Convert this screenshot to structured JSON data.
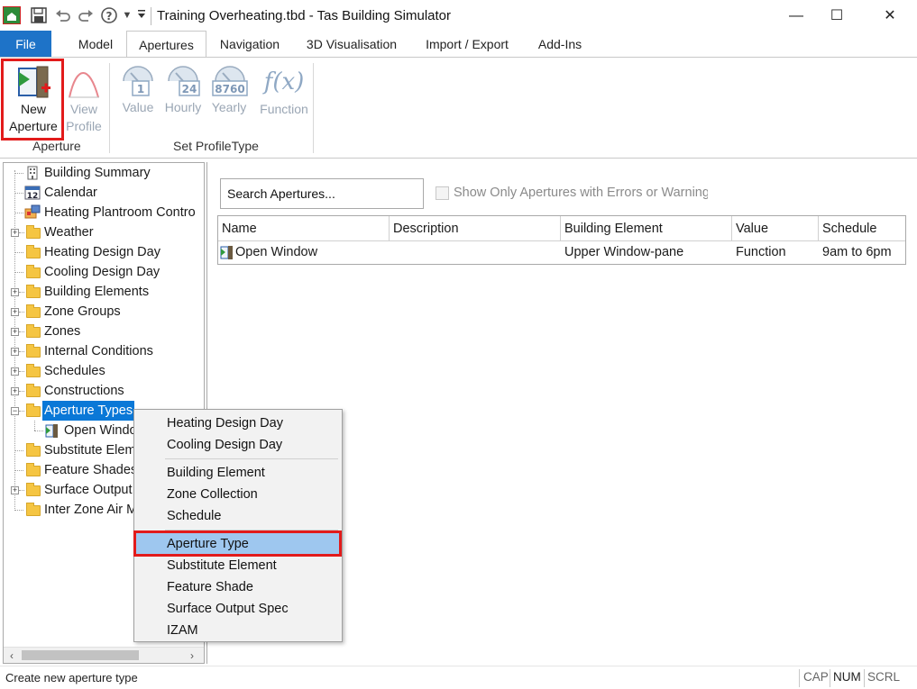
{
  "window": {
    "title": "Training Overheating.tbd - Tas Building Simulator",
    "minimize": "—",
    "maximize": "☐",
    "close": "✕"
  },
  "quick_access": {
    "icons": [
      "app-icon",
      "save-icon",
      "undo-icon",
      "redo-icon",
      "help-icon",
      "dropdown-icon",
      "customize-icon"
    ]
  },
  "tabs": [
    {
      "label": "File"
    },
    {
      "label": "Model"
    },
    {
      "label": "Apertures"
    },
    {
      "label": "Navigation"
    },
    {
      "label": "3D Visualisation"
    },
    {
      "label": "Import / Export"
    },
    {
      "label": "Add-Ins"
    }
  ],
  "ribbon": {
    "aperture_group": {
      "label": "Aperture",
      "new_aperture": {
        "line1": "New",
        "line2": "Aperture"
      },
      "view_profile": {
        "line1": "View",
        "line2": "Profile"
      }
    },
    "profile_group": {
      "label": "Set ProfileType",
      "value": {
        "label": "Value",
        "badge": "1"
      },
      "hourly": {
        "label": "Hourly",
        "badge": "24"
      },
      "yearly": {
        "label": "Yearly",
        "badge": "8760"
      },
      "function": {
        "label": "Function",
        "symbol": "f(x)"
      }
    }
  },
  "tree": {
    "items": [
      {
        "label": "Building Summary"
      },
      {
        "label": "Calendar"
      },
      {
        "label": "Heating Plantroom Contro"
      },
      {
        "label": "Weather"
      },
      {
        "label": "Heating Design Day"
      },
      {
        "label": "Cooling Design Day"
      },
      {
        "label": "Building Elements"
      },
      {
        "label": "Zone Groups"
      },
      {
        "label": "Zones"
      },
      {
        "label": "Internal Conditions"
      },
      {
        "label": "Schedules"
      },
      {
        "label": "Constructions"
      },
      {
        "label": "Aperture Types"
      },
      {
        "label": "Open Windo"
      },
      {
        "label": "Substitute Elem"
      },
      {
        "label": "Feature Shades"
      },
      {
        "label": "Surface Output"
      },
      {
        "label": "Inter Zone Air M"
      }
    ],
    "calendar_badge": "12"
  },
  "search": {
    "value": "Search Apertures..."
  },
  "filter": {
    "label": "Show Only Apertures with Errors or Warnings"
  },
  "table": {
    "columns": [
      "Name",
      "Description",
      "Building Element",
      "Value",
      "Schedule"
    ],
    "rows": [
      {
        "name": "Open Window",
        "description": "",
        "building_element": "Upper Window-pane",
        "value": "Function",
        "schedule": "9am to 6pm"
      }
    ]
  },
  "context_menu": {
    "items": [
      {
        "label": "Heating Design Day"
      },
      {
        "label": "Cooling Design Day"
      },
      {
        "label": "Building Element"
      },
      {
        "label": "Zone Collection"
      },
      {
        "label": "Schedule"
      },
      {
        "label": "Aperture Type"
      },
      {
        "label": "Substitute Element"
      },
      {
        "label": "Feature Shade"
      },
      {
        "label": "Surface Output Spec"
      },
      {
        "label": "IZAM"
      }
    ]
  },
  "status": {
    "text": "Create new aperture type",
    "cap": "CAP",
    "num": "NUM",
    "scrl": "SCRL"
  },
  "colors": {
    "accent": "#1e73c8",
    "selection": "#0a78d7",
    "menu_hover": "#9ec7ef",
    "highlight": "#e21b1b"
  }
}
